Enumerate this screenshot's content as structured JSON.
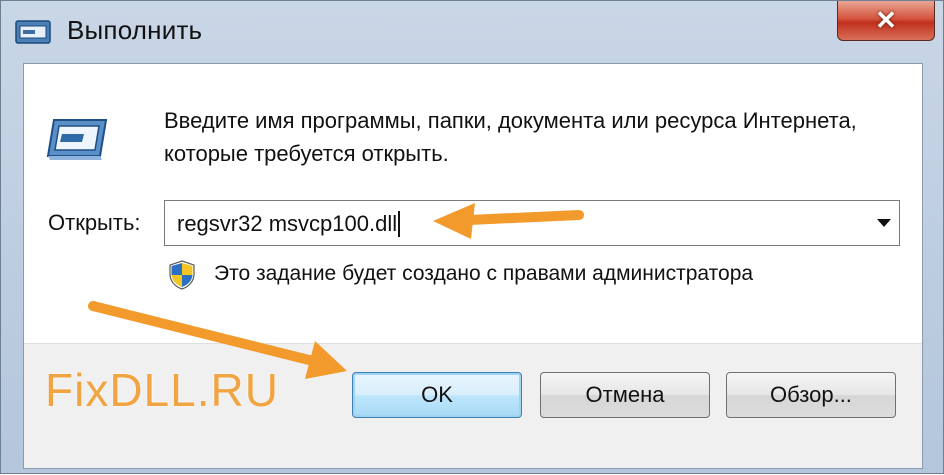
{
  "window": {
    "title": "Выполнить",
    "close_label": "✕"
  },
  "dialog": {
    "description": "Введите имя программы, папки, документа или ресурса Интернета, которые требуется открыть.",
    "open_label": "Открыть:",
    "open_value": "regsvr32 msvcp100.dll",
    "admin_note": "Это задание будет создано с правами администратора"
  },
  "buttons": {
    "ok": "OK",
    "cancel": "Отмена",
    "browse": "Обзор..."
  },
  "watermark": "FixDLL.RU",
  "colors": {
    "accent_arrow": "#f39a2c",
    "ok_button_border": "#3c7fb1",
    "close_button": "#c1301c"
  }
}
